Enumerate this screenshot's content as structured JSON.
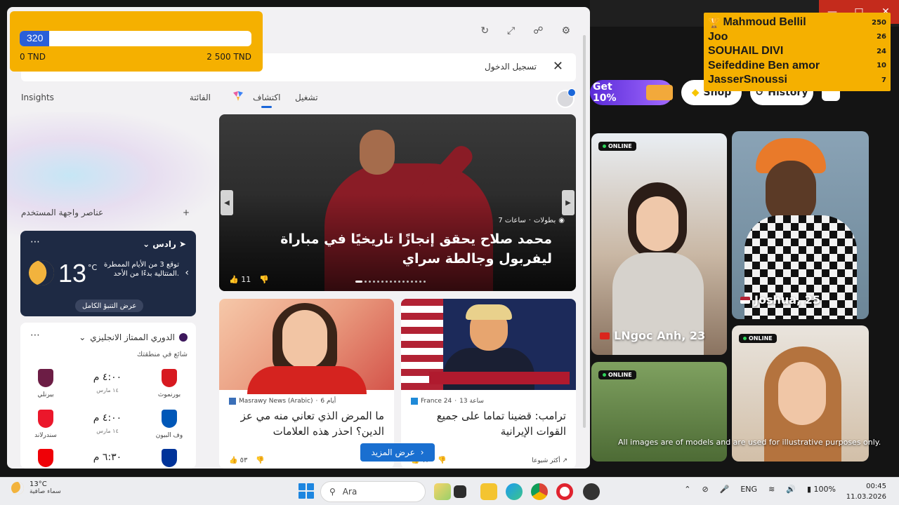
{
  "goal_overlay": {
    "current": "320",
    "progress_fraction": 0.128,
    "min_label": "0 TND",
    "max_label": "2 500 TND"
  },
  "leaderboard": [
    {
      "name": "Mahmoud Bellil",
      "score": "250"
    },
    {
      "name": "Joo",
      "score": "26"
    },
    {
      "name": "SOUHAIL DIVI",
      "score": "24"
    },
    {
      "name": "Seifeddine Ben amor",
      "score": "10"
    },
    {
      "name": "JasserSnoussi",
      "score": "7"
    }
  ],
  "site": {
    "promo_label": "Get 10%",
    "shop_label": "Shop",
    "history_label": "History",
    "online_label": "ONLINE",
    "profiles": [
      {
        "name": "Joshua, 25"
      },
      {
        "name": "LNgoc Anh, 23"
      }
    ],
    "disclaimer": "All images are of models and are used for illustrative purposes only."
  },
  "widgets": {
    "signin_label": "تسجيل الدخول",
    "tabs": [
      "تشغيل",
      "اكتشاف"
    ],
    "insights_label": "Insights",
    "missed_label": "الفائتة",
    "ui_elements_label": "عناصر واجهة المستخدم",
    "add_icon": "+",
    "weather": {
      "location": "رادس",
      "temp": "13",
      "unit": "°C",
      "forecast": "توقع 3 من الأيام الممطرة المتتالية بدءًا من الأحد.",
      "full_forecast": "عرض التنبؤ الكامل"
    },
    "league": {
      "title": "الدوري الممتاز الانجليزي",
      "trending": "شائع في منطقتك",
      "matches": [
        {
          "home": "بورنموث",
          "away": "بيرنلي",
          "time": "٤:٠٠ م",
          "date": "١٤ مارس",
          "home_color": "#d71920",
          "away_color": "#6c1d45"
        },
        {
          "home": "وف البيون",
          "away": "سندرلاند",
          "time": "٤:٠٠ م",
          "date": "١٤ مارس",
          "home_color": "#0057b8",
          "away_color": "#eb172b"
        },
        {
          "home": "",
          "away": "",
          "time": "٦:٣٠ م",
          "date": "",
          "home_color": "#003399",
          "away_color": "#ef0107"
        }
      ]
    },
    "hero": {
      "source": "بطولات",
      "age": "ساعات 7",
      "title": "محمد صلاح يحقق إنجازًا تاريخيًا في مباراة ليفربول وجالطة سراي",
      "likes": "11"
    },
    "cards": [
      {
        "source": "Masrawy News (Arabic)",
        "age": "أيام 6",
        "title": "ما المرض الذي تعاني منه مي عز الدين؟ احذر هذه العلامات",
        "likes": "٥٣"
      },
      {
        "source": "France 24",
        "age": "ساعة 13",
        "title": "ترامب: قضينا تماما على جميع القوات الإيرانية",
        "likes": "١٣",
        "trend": "أكثر شيوعا"
      }
    ],
    "show_more": "عرض المزيد"
  },
  "taskbar": {
    "weather_temp": "13°C",
    "weather_desc": "سماء صافية",
    "search_label": "Ara",
    "lang": "ENG",
    "battery": "100%",
    "time": "00:45",
    "date": "11.03.2026"
  }
}
